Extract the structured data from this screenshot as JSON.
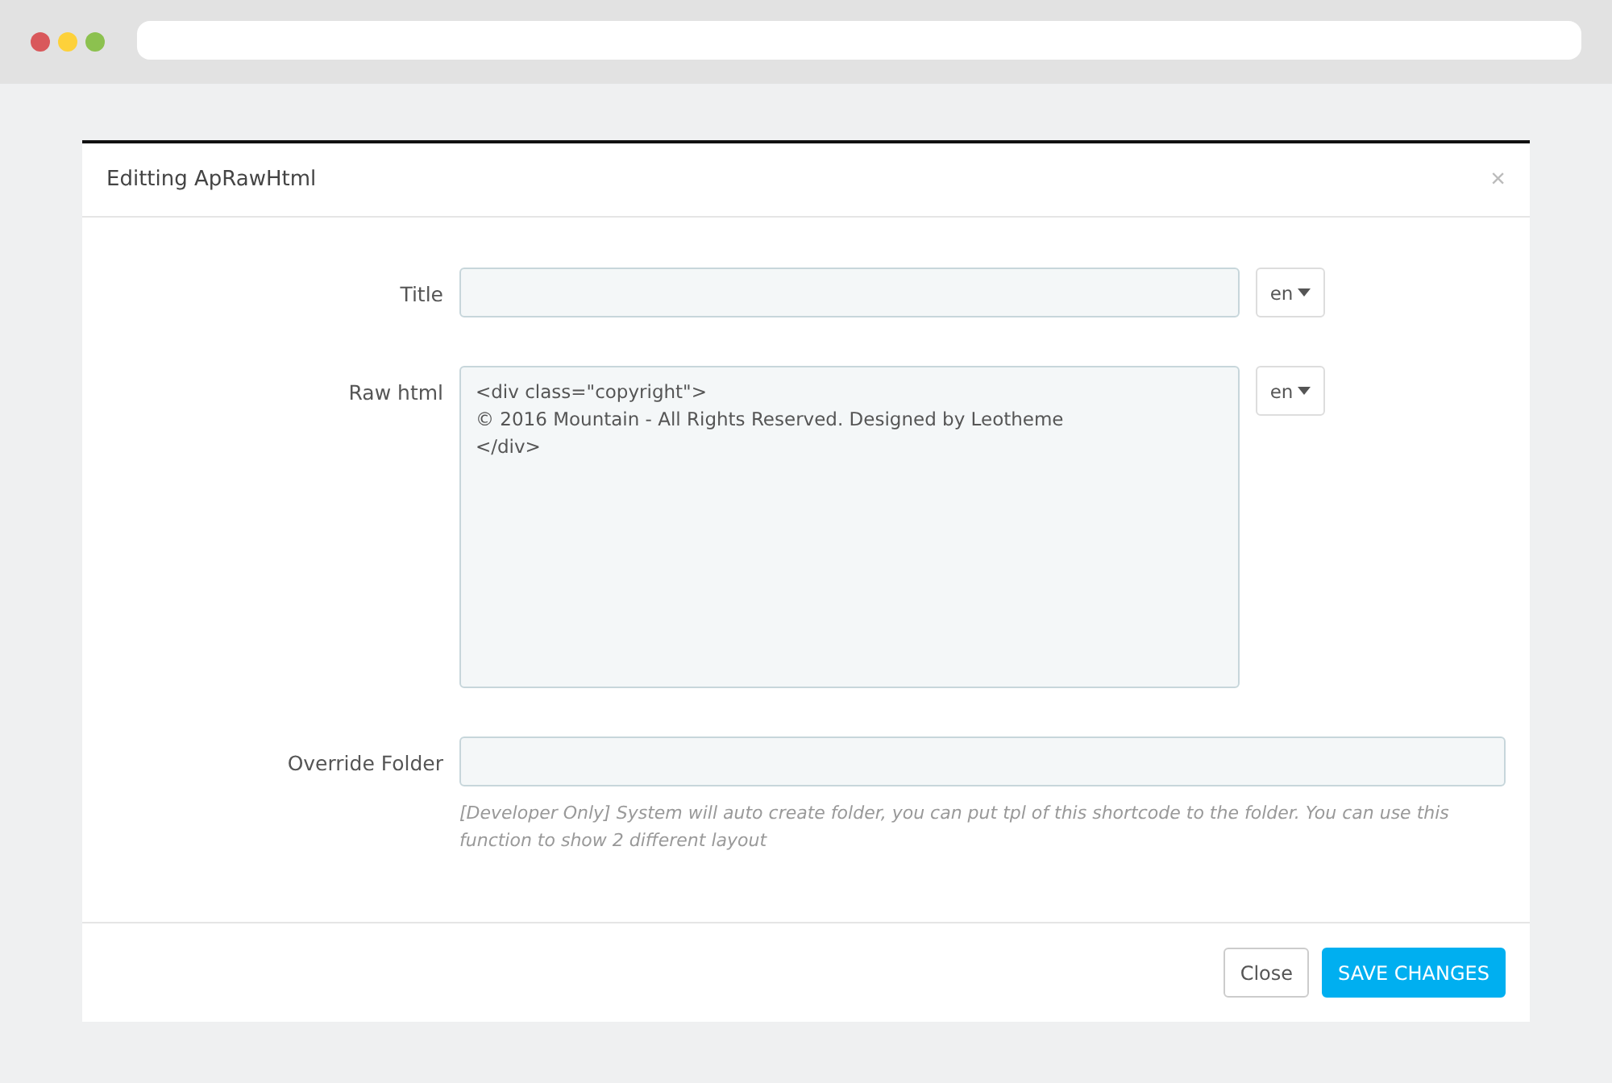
{
  "modal": {
    "title": "Editting ApRawHtml",
    "close_icon": "×"
  },
  "fields": [
    {
      "kind": "input",
      "label": "Title",
      "language": "en"
    },
    {
      "kind": "textarea",
      "label": "Raw html",
      "value": "<div class=\"copyright\">\n© 2016 Mountain - All Rights Reserved. Designed by Leotheme\n</div>",
      "language": "en"
    },
    {
      "kind": "wide-input",
      "label": "Override Folder",
      "help": "[Developer Only] System will auto create folder, you can put tpl of this shortcode to the folder. You can use this function to show 2 different layout"
    }
  ],
  "buttons": [
    {
      "label": "Close",
      "kind": "default"
    },
    {
      "label": "SAVE CHANGES",
      "kind": "primary"
    }
  ]
}
